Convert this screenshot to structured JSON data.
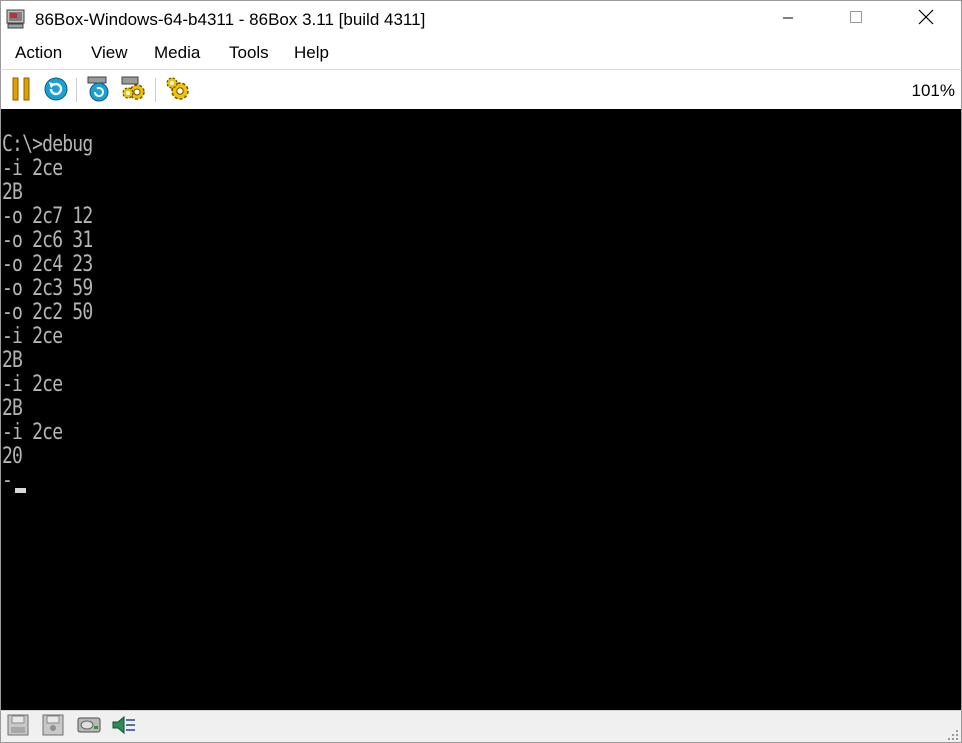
{
  "window": {
    "title": "86Box-Windows-64-b4311 - 86Box 3.11 [build 4311]",
    "app_icon": "86box-computer-icon",
    "controls": [
      "minimize-icon",
      "maximize-icon",
      "close-icon"
    ]
  },
  "menubar": {
    "items": [
      "Action",
      "View",
      "Media",
      "Tools",
      "Help"
    ]
  },
  "toolbar": {
    "buttons": [
      {
        "name": "pause-button",
        "icon": "pause-icon",
        "color": "#e0a000"
      },
      {
        "name": "hard-reset-button",
        "icon": "reset-icon",
        "color": "#1a9fd6"
      },
      {
        "name": "ctrl-alt-del-button",
        "icon": "ctrl-alt-del-icon"
      },
      {
        "name": "settings-button",
        "icon": "gear-icon"
      },
      {
        "name": "machine-settings-button",
        "icon": "gear-settings-icon"
      }
    ],
    "zoom": "101%"
  },
  "screen": {
    "background": "#000000",
    "text_color": "#b4b4b4",
    "lines": [
      "C:\\>debug",
      "-i 2ce",
      "2B",
      "-o 2c7 12",
      "-o 2c6 31",
      "-o 2c4 23",
      "-o 2c3 59",
      "-o 2c2 50",
      "-i 2ce",
      "2B",
      "-i 2ce",
      "2B",
      "-i 2ce",
      "20",
      "-"
    ]
  },
  "statusbar": {
    "icons": [
      "floppy-drive-a-icon",
      "floppy-drive-b-icon",
      "hard-disk-icon",
      "sound-icon"
    ]
  }
}
